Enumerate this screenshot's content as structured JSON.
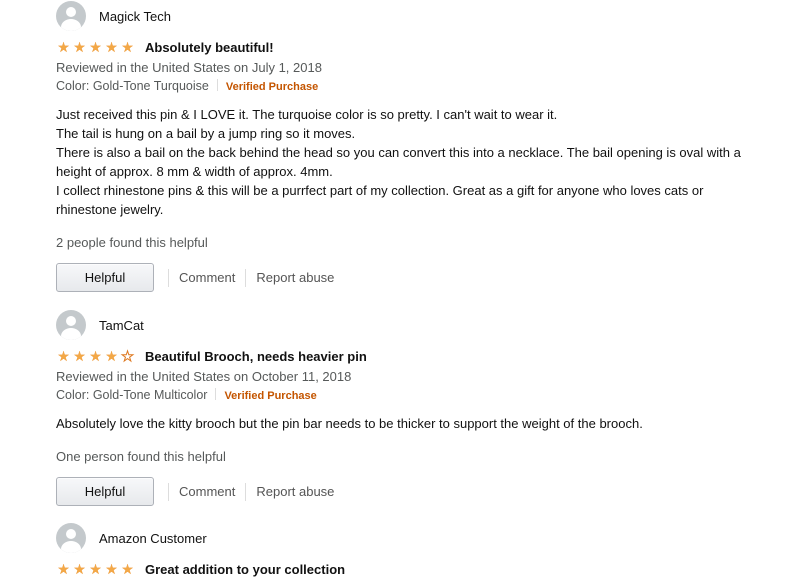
{
  "reviews": [
    {
      "name": "Magick Tech",
      "stars": 5,
      "title": "Absolutely beautiful!",
      "date": "Reviewed in the United States on July 1, 2018",
      "variant": "Color: Gold-Tone Turquoise",
      "verified": "Verified Purchase",
      "body": [
        "Just received this pin & I LOVE it. The turquoise color is so pretty. I can't wait to wear it.",
        "The tail is hung on a bail by a jump ring so it moves.",
        "There is also a bail on the back behind the head so you can convert this into a necklace. The bail opening is oval with a height of approx. 8 mm & width of approx. 4mm.",
        "I collect rhinestone pins & this will be a purrfect part of my collection. Great as a gift for anyone who loves cats or rhinestone jewelry."
      ],
      "helpful_count": "2 people found this helpful",
      "helpful_label": "Helpful",
      "comment_label": "Comment",
      "report_label": "Report abuse"
    },
    {
      "name": "TamCat",
      "stars": 4,
      "title": "Beautiful Brooch, needs heavier pin",
      "date": "Reviewed in the United States on October 11, 2018",
      "variant": "Color: Gold-Tone Multicolor",
      "verified": "Verified Purchase",
      "body": [
        "Absolutely love the kitty brooch but the pin bar needs to be thicker to support the weight of the brooch."
      ],
      "helpful_count": "One person found this helpful",
      "helpful_label": "Helpful",
      "comment_label": "Comment",
      "report_label": "Report abuse"
    },
    {
      "name": "Amazon Customer",
      "stars": 5,
      "title": "Great addition to your collection"
    }
  ],
  "colors": {
    "star": "#f3a847",
    "verified": "#c45500",
    "meta": "#565959"
  }
}
